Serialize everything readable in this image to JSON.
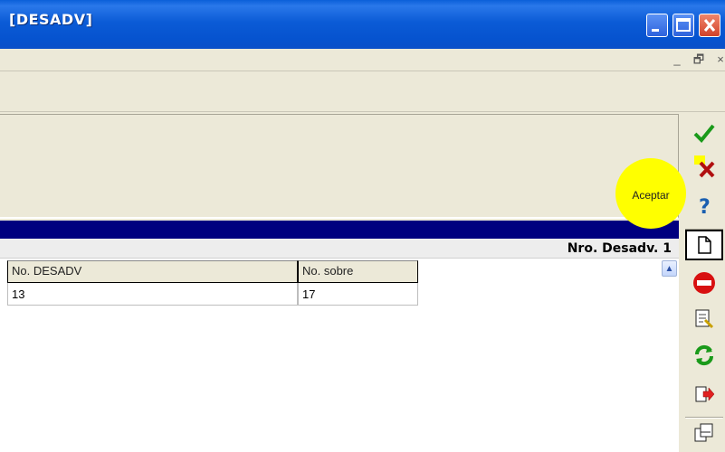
{
  "window": {
    "title": "[DESADV]"
  },
  "mdi": {
    "minimize": "_",
    "restore": "🗗",
    "close": "×"
  },
  "info": {
    "record_label": "Nro. Desadv. 1"
  },
  "table": {
    "columns": [
      "No. DESADV",
      "No. sobre"
    ],
    "rows": [
      [
        "13",
        "17"
      ]
    ]
  },
  "toolbar": {
    "accept_tooltip": "Aceptar",
    "buttons": [
      "accept-icon",
      "cancel-icon",
      "help-icon",
      "new-document-icon",
      "delete-icon",
      "edit-document-icon",
      "refresh-icon",
      "export-icon",
      "copy-icon"
    ]
  },
  "colors": {
    "title_bar": "#0a5fd9",
    "band": "#00007f",
    "tooltip": "#ffff00"
  }
}
